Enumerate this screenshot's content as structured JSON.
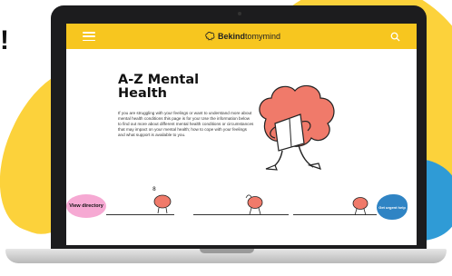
{
  "edge_text": "!",
  "site": {
    "logo": {
      "bold": "Bekind",
      "regular": "tomymind"
    },
    "menu_icon": "hamburger-icon",
    "search_icon": "search-icon"
  },
  "hero": {
    "title_line1": "A-Z Mental",
    "title_line2": "Health",
    "body": "If you are struggling with your feelings or want to understand more about mental health conditions this page is for you! Use the information below to find out more about different mental health conditions or circumstances that may impact on your mental health; how to cope with your feelings and what support is available to you."
  },
  "actions": {
    "view_directory": "View directory",
    "get_urgent_help": "Get urgent help"
  },
  "colors": {
    "header": "#f7c61f",
    "accent_pink": "#f6a9d3",
    "accent_blue": "#2f84c4",
    "brain": "#f07a6a",
    "background_yellow": "#fcd23b"
  }
}
